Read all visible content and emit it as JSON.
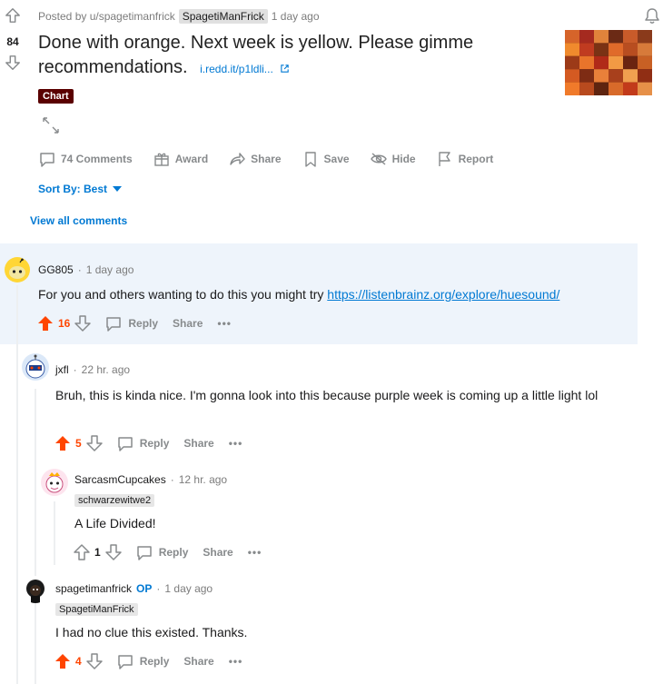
{
  "post": {
    "posted_by": "Posted by u/spagetimanfrick",
    "author_flair": "SpagetiManFrick",
    "time": "1 day ago",
    "score": "84",
    "title": "Done with orange. Next week is yellow. Please gimme recommendations.",
    "link_text": "i.redd.it/p1ldli...",
    "link_flair": "Chart"
  },
  "actions": {
    "comments": "74 Comments",
    "award": "Award",
    "share": "Share",
    "save": "Save",
    "hide": "Hide",
    "report": "Report"
  },
  "sort": {
    "label": "Sort By: Best"
  },
  "view_all": "View all comments",
  "comments": [
    {
      "user": "GG805",
      "time": "1 day ago",
      "text_prefix": "For you and others wanting to do this you might try ",
      "link": "https://listenbrainz.org/explore/huesound/",
      "score": "16",
      "reply": "Reply",
      "share": "Share"
    },
    {
      "user": "jxfl",
      "time": "22 hr. ago",
      "text": "Bruh, this is kinda nice. I'm gonna look into this because purple week is coming up a little light lol",
      "score": "5",
      "reply": "Reply",
      "share": "Share"
    },
    {
      "user": "SarcasmCupcakes",
      "time": "12 hr. ago",
      "flair": "schwarzewitwe2",
      "text": "A Life Divided!",
      "score": "1",
      "reply": "Reply",
      "share": "Share"
    },
    {
      "user": "spagetimanfrick",
      "op": "OP",
      "time": "1 day ago",
      "flair": "SpagetiManFrick",
      "text": "I had no clue this existed. Thanks.",
      "score": "4",
      "reply": "Reply",
      "share": "Share"
    }
  ],
  "colors": {
    "accent": "#0079d3",
    "upvote": "#ff4500",
    "highlight": "#eef4fb",
    "flair_bg": "#5a0000"
  }
}
